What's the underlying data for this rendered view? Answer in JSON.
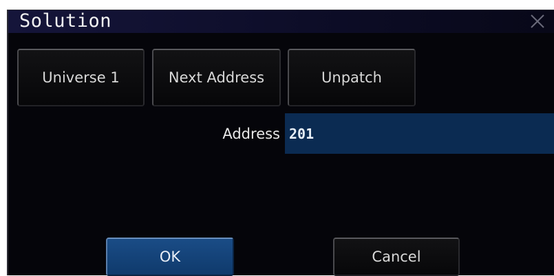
{
  "dialog": {
    "title": "Solution",
    "close_icon": "close-icon"
  },
  "toolbar": {
    "universe_label": "Universe 1",
    "next_address_label": "Next Address",
    "unpatch_label": "Unpatch"
  },
  "address": {
    "label": "Address",
    "value": "201"
  },
  "footer": {
    "ok_label": "OK",
    "cancel_label": "Cancel"
  },
  "colors": {
    "background": "#05050a",
    "titlebar": "#15153a",
    "accent": "#1a4c86",
    "input_background": "#0b2b52",
    "text": "#d8d8d8"
  }
}
